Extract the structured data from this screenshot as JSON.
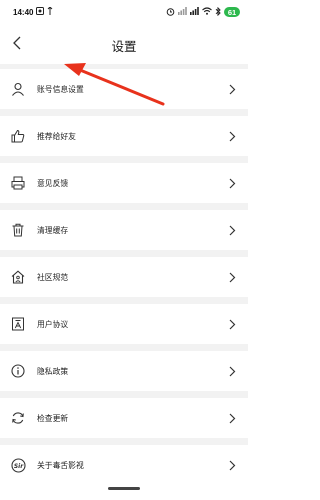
{
  "status_bar": {
    "time": "14:40",
    "left_icons": [
      "photo-icon",
      "signal-alt-icon"
    ],
    "right_icons": [
      "alarm-icon",
      "signal-icon",
      "signal-icon",
      "wifi-icon",
      "bluetooth-icon"
    ],
    "battery": "61"
  },
  "header": {
    "title": "设置"
  },
  "settings": [
    {
      "label": "账号信息设置",
      "icon": "person-icon"
    },
    {
      "label": "推荐给好友",
      "icon": "thumbs-up-icon"
    },
    {
      "label": "意见反馈",
      "icon": "feedback-printer-icon"
    },
    {
      "label": "清理缓存",
      "icon": "trash-icon"
    },
    {
      "label": "社区规范",
      "icon": "house-icon"
    },
    {
      "label": "用户协议",
      "icon": "agreement-document-icon"
    },
    {
      "label": "隐私政策",
      "icon": "info-icon"
    },
    {
      "label": "检查更新",
      "icon": "refresh-icon"
    },
    {
      "label": "关于毒舌影视",
      "icon": "sir-logo-icon"
    }
  ],
  "annotation": {
    "arrow_color": "#e8321c"
  }
}
